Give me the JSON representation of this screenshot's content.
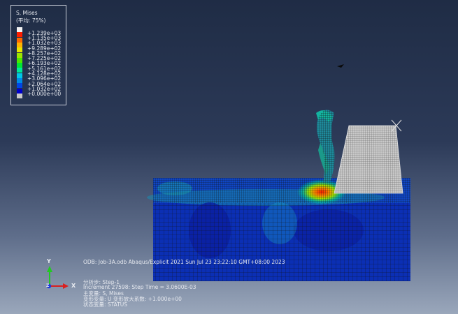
{
  "legend": {
    "title": "S, Mises",
    "subtitle": "(平均: 75%)",
    "values": [
      "+1.239e+03",
      "+1.135e+03",
      "+1.032e+03",
      "+9.289e+02",
      "+8.257e+02",
      "+7.225e+02",
      "+6.193e+02",
      "+5.161e+02",
      "+4.128e+02",
      "+3.096e+02",
      "+2.064e+02",
      "+1.032e+02",
      "+0.000e+00"
    ],
    "colors": [
      "#f2f2f2",
      "#ff1e00",
      "#ff6a00",
      "#ffb300",
      "#e6e600",
      "#9ce600",
      "#4de600",
      "#00e632",
      "#00e699",
      "#00c8e6",
      "#008ce6",
      "#0046e6",
      "#0000cd",
      "#c8c8c8"
    ]
  },
  "status": {
    "odb_line": "ODB: Job-3A.odb    Abaqus/Explicit 2021    Sun Jul 23 23:22:10 GMT+08:00 2023",
    "step_line": "分析步: Step-1",
    "increment_line": "Increment     27598: Step Time =    3.0600E-03",
    "primary_var_line": "主变量: S, Mises",
    "deformed_var_line": "变形变量: U   变形放大系数: +1.000e+00",
    "status_var_line": "状态变量: STATUS"
  },
  "triad": {
    "y": "Y",
    "x": "X",
    "z": "Z"
  }
}
